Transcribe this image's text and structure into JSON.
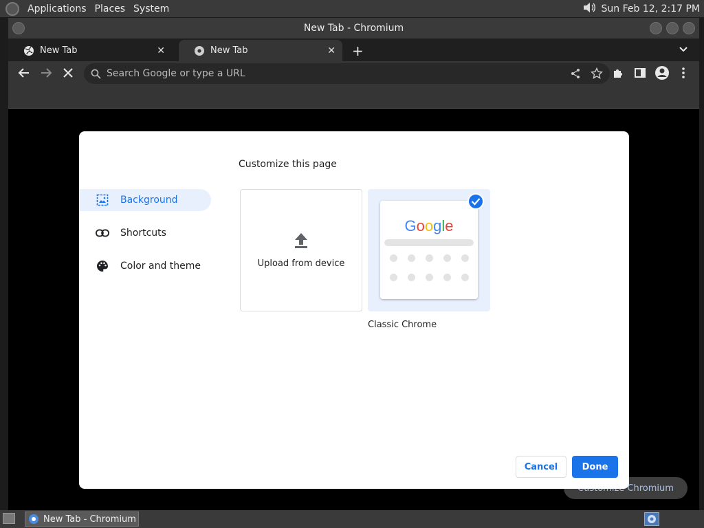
{
  "top_panel": {
    "menus": [
      "Applications",
      "Places",
      "System"
    ],
    "clock": "Sun Feb 12,  2:17 PM"
  },
  "window": {
    "title": "New Tab - Chromium"
  },
  "tabs": [
    {
      "label": "New Tab",
      "active": false
    },
    {
      "label": "New Tab",
      "active": true
    }
  ],
  "omnibox": {
    "placeholder": "Search Google or type a URL"
  },
  "dialog": {
    "title": "Customize this page",
    "nav": [
      {
        "label": "Background",
        "icon": "image-icon",
        "selected": true
      },
      {
        "label": "Shortcuts",
        "icon": "link-icon",
        "selected": false
      },
      {
        "label": "Color and theme",
        "icon": "palette-icon",
        "selected": false
      }
    ],
    "upload_label": "Upload from device",
    "classic_label": "Classic Chrome",
    "google_logo": [
      "G",
      "o",
      "o",
      "g",
      "l",
      "e"
    ],
    "cancel_label": "Cancel",
    "done_label": "Done"
  },
  "customize_button_label": "Customize Chromium",
  "taskbar": {
    "item_label": "New Tab - Chromium"
  },
  "colors": {
    "accent": "#1a73e8",
    "selected_nav_bg": "#e8f0fe",
    "google_blue": "#4285f4",
    "google_red": "#ea4335",
    "google_yellow": "#fbbc05",
    "google_green": "#34a853"
  }
}
